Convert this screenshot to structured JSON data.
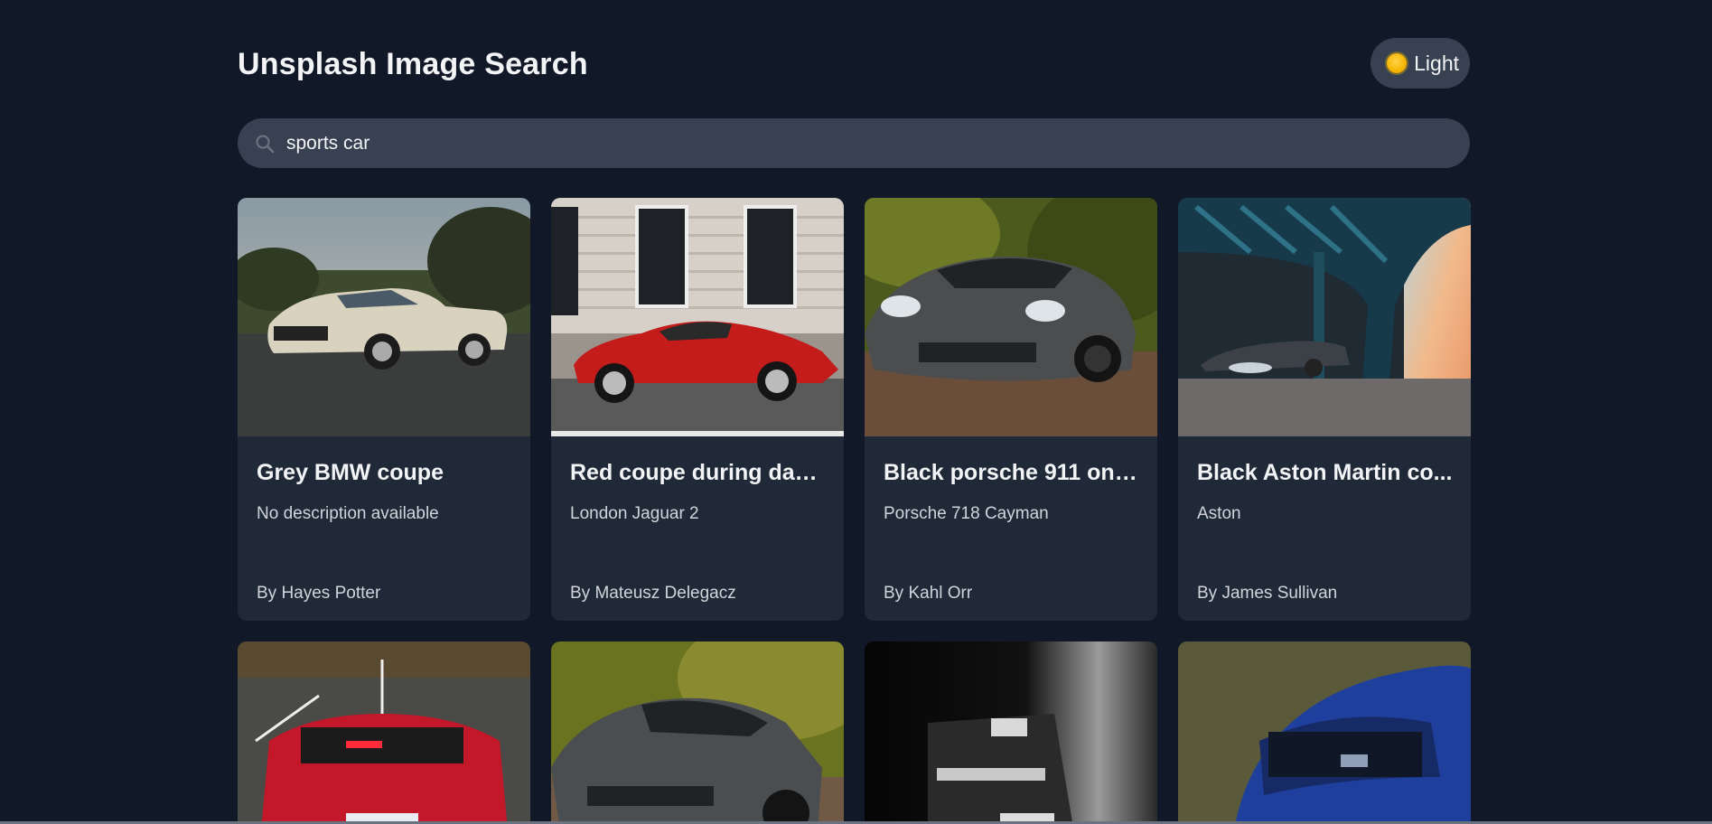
{
  "header": {
    "title": "Unsplash Image Search",
    "theme_toggle_label": "Light",
    "theme_icon": "sun-icon"
  },
  "search": {
    "value": "sports car",
    "icon": "search-icon"
  },
  "results": [
    {
      "title": "Grey BMW coupe",
      "description": "No description available",
      "author": "By Hayes Potter"
    },
    {
      "title": "Red coupe during dayt...",
      "description": "London Jaguar 2",
      "author": "By Mateusz Delegacz"
    },
    {
      "title": "Black porsche 911 on r...",
      "description": "Porsche 718 Cayman",
      "author": "By Kahl Orr"
    },
    {
      "title": "Black Aston Martin co...",
      "description": "Aston",
      "author": "By James Sullivan"
    }
  ],
  "colors": {
    "background": "#111827",
    "card": "#1f2937",
    "control": "#374151",
    "text": "#f3f4f6",
    "muted_text": "#d1d5db"
  }
}
